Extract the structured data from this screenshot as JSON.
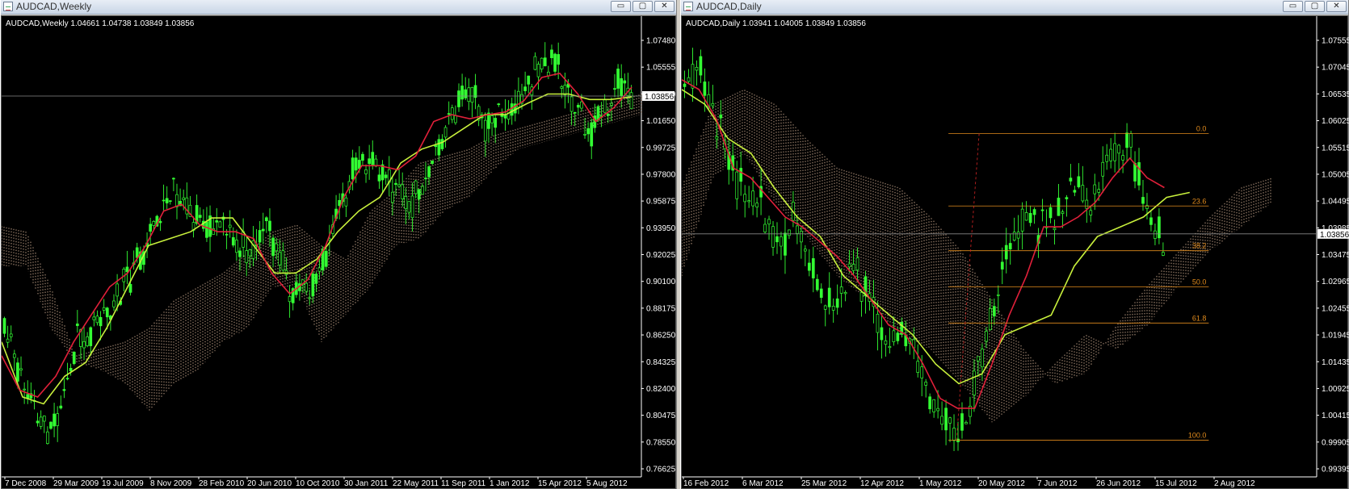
{
  "windows": [
    {
      "title": "AUDCAD,Weekly",
      "header": "AUDCAD,Weekly  1.04661 1.04738 1.03849 1.03856",
      "price_label": "1.03856"
    },
    {
      "title": "AUDCAD,Daily",
      "header": "AUDCAD,Daily  1.03941 1.04005 1.03849 1.03856",
      "price_label": "1.03856"
    }
  ],
  "buttons": {
    "minimize": "▭",
    "maximize": "▢",
    "close": "✕"
  },
  "chart_data": [
    {
      "type": "candlestick",
      "symbol": "AUDCAD",
      "timeframe": "Weekly",
      "ohlc": {
        "open": 1.04661,
        "high": 1.04738,
        "low": 1.03849,
        "close": 1.03856
      },
      "ylim": [
        0.762,
        1.086
      ],
      "y_ticks": [
        "1.07480",
        "1.05555",
        "1.03630",
        "1.01650",
        "0.99725",
        "0.97800",
        "0.95875",
        "0.93950",
        "0.92025",
        "0.90100",
        "0.88175",
        "0.86250",
        "0.84325",
        "0.82400",
        "0.80475",
        "0.78550",
        "0.76625"
      ],
      "x_ticks": [
        "7 Dec 2008",
        "29 Mar 2009",
        "19 Jul 2009",
        "8 Nov 2009",
        "28 Feb 2010",
        "20 Jun 2010",
        "10 Oct 2010",
        "30 Jan 2011",
        "22 May 2011",
        "11 Sep 2011",
        "1 Jan 2012",
        "15 Apr 2012",
        "5 Aug 2012"
      ],
      "current_price": 1.03856,
      "series": {
        "price": [
          0.868,
          0.842,
          0.808,
          0.792,
          0.815,
          0.86,
          0.868,
          0.877,
          0.9,
          0.915,
          0.938,
          0.958,
          0.968,
          0.955,
          0.942,
          0.948,
          0.93,
          0.925,
          0.945,
          0.918,
          0.892,
          0.9,
          0.918,
          0.955,
          0.985,
          0.99,
          0.98,
          0.972,
          0.96,
          0.985,
          1.005,
          1.03,
          1.04,
          1.02,
          1.022,
          1.025,
          1.05,
          1.065,
          1.055,
          1.04,
          1.01,
          1.025,
          1.045,
          1.0385
        ],
        "tenkan": [
          0.85,
          0.825,
          0.82,
          0.835,
          0.86,
          0.88,
          0.9,
          0.91,
          0.93,
          0.955,
          0.96,
          0.945,
          0.94,
          0.94,
          0.935,
          0.91,
          0.895,
          0.905,
          0.93,
          0.965,
          0.988,
          0.988,
          0.985,
          0.995,
          1.02,
          1.025,
          1.022,
          1.025,
          1.027,
          1.035,
          1.052,
          1.055,
          1.04,
          1.02,
          1.03,
          1.045
        ],
        "kijun": [
          0.86,
          0.82,
          0.815,
          0.835,
          0.845,
          0.87,
          0.9,
          0.93,
          0.935,
          0.94,
          0.95,
          0.95,
          0.93,
          0.91,
          0.91,
          0.92,
          0.94,
          0.955,
          0.965,
          0.99,
          1.0,
          1.005,
          1.015,
          1.025,
          1.025,
          1.033,
          1.04,
          1.04,
          1.036,
          1.036,
          1.038
        ],
        "cloud_top": [
          0.944,
          0.94,
          0.9,
          0.85,
          0.855,
          0.86,
          0.87,
          0.89,
          0.9,
          0.91,
          0.925,
          0.94,
          0.945,
          0.93,
          0.92,
          0.955,
          0.97,
          0.99,
          0.995,
          1.0,
          1.01,
          1.015,
          1.02,
          1.025,
          1.03,
          1.035,
          1.04
        ],
        "cloud_bottom": [
          0.915,
          0.915,
          0.87,
          0.845,
          0.84,
          0.83,
          0.81,
          0.83,
          0.84,
          0.86,
          0.87,
          0.9,
          0.9,
          0.86,
          0.88,
          0.9,
          0.93,
          0.935,
          0.955,
          0.965,
          0.985,
          1.0,
          1.005,
          1.01,
          1.015,
          1.02,
          1.025
        ]
      }
    },
    {
      "type": "candlestick",
      "symbol": "AUDCAD",
      "timeframe": "Daily",
      "ohlc": {
        "open": 1.03941,
        "high": 1.04005,
        "low": 1.03849,
        "close": 1.03856
      },
      "ylim": [
        0.989,
        1.08
      ],
      "y_ticks": [
        "1.07555",
        "1.07045",
        "1.06535",
        "1.06025",
        "1.05515",
        "1.05005",
        "1.04495",
        "1.03985",
        "1.03475",
        "1.02965",
        "1.02455",
        "1.01945",
        "1.01435",
        "1.00925",
        "1.00415",
        "0.99905",
        "0.99395"
      ],
      "x_ticks": [
        "16 Feb 2012",
        "6 Mar 2012",
        "25 Mar 2012",
        "12 Apr 2012",
        "1 May 2012",
        "20 May 2012",
        "7 Jun 2012",
        "26 Jun 2012",
        "15 Jul 2012",
        "2 Aug 2012"
      ],
      "current_price": 1.03856,
      "fibonacci": {
        "from": 0.9965,
        "to": 1.059,
        "levels": [
          {
            "ratio": 0.0,
            "label": "0.0"
          },
          {
            "ratio": 0.236,
            "label": "23.6"
          },
          {
            "ratio": 0.382,
            "label": "38.2"
          },
          {
            "ratio": 0.5,
            "label": "50.0"
          },
          {
            "ratio": 0.618,
            "label": "61.8"
          },
          {
            "ratio": 1.0,
            "label": "100.0"
          }
        ]
      },
      "series": {
        "price": [
          1.068,
          1.072,
          1.066,
          1.06,
          1.05,
          1.048,
          1.045,
          1.04,
          1.036,
          1.042,
          1.035,
          1.03,
          1.025,
          1.028,
          1.032,
          1.025,
          1.02,
          1.015,
          1.018,
          1.012,
          1.006,
          1.002,
          0.998,
          1.0,
          1.012,
          1.022,
          1.032,
          1.04,
          1.044,
          1.04,
          1.042,
          1.047,
          1.048,
          1.045,
          1.052,
          1.056,
          1.058,
          1.05,
          1.04,
          1.0385
        ],
        "tenkan": [
          1.07,
          1.068,
          1.062,
          1.052,
          1.05,
          1.046,
          1.042,
          1.04,
          1.037,
          1.034,
          1.03,
          1.025,
          1.02,
          1.018,
          1.012,
          1.005,
          1.003,
          1.003,
          1.012,
          1.022,
          1.03,
          1.04,
          1.04,
          1.042,
          1.045,
          1.05,
          1.054,
          1.05,
          1.048
        ],
        "kijun": [
          1.068,
          1.065,
          1.058,
          1.055,
          1.048,
          1.042,
          1.038,
          1.03,
          1.026,
          1.022,
          1.018,
          1.012,
          1.008,
          1.01,
          1.018,
          1.02,
          1.022,
          1.032,
          1.038,
          1.04,
          1.042,
          1.046,
          1.047
        ],
        "cloud_top": [
          1.048,
          1.065,
          1.068,
          1.065,
          1.058,
          1.052,
          1.05,
          1.048,
          1.042,
          1.035,
          1.025,
          1.015,
          1.008,
          1.01,
          1.02,
          1.028,
          1.035,
          1.042,
          1.048,
          1.05
        ],
        "cloud_bottom": [
          1.03,
          1.05,
          1.055,
          1.045,
          1.038,
          1.03,
          1.025,
          1.018,
          1.015,
          1.008,
          1.0,
          1.005,
          1.012,
          1.018,
          1.015,
          1.02,
          1.028,
          1.035,
          1.04,
          1.045
        ]
      }
    }
  ],
  "colors": {
    "background": "#000000",
    "bull": "#33ff33",
    "tenkan": "#e0203a",
    "kijun": "#c8f03c",
    "cloud": "#f0c8a8",
    "fib": "#e08a1c",
    "text": "#ffffff"
  }
}
